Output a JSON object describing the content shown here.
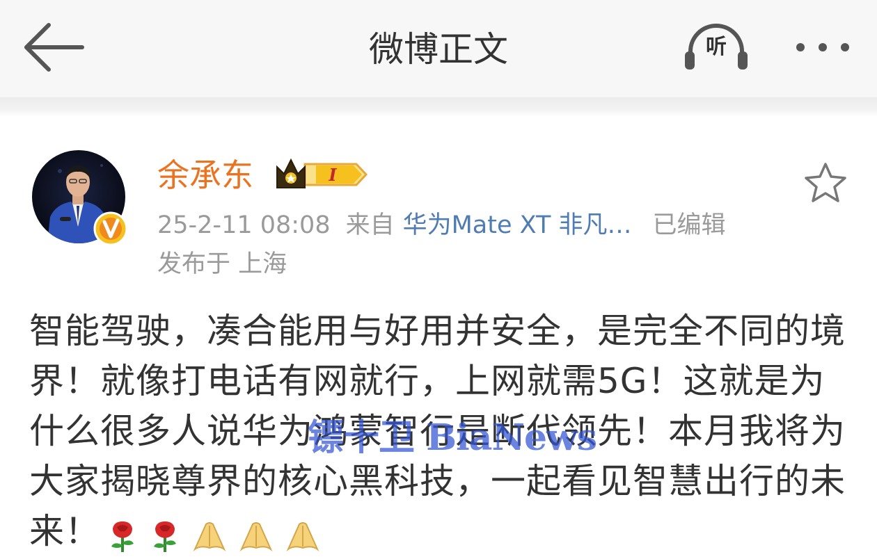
{
  "header": {
    "title": "微博正文",
    "listen_label": "听"
  },
  "post": {
    "author": "余承东",
    "timestamp": "25-2-11 08:08",
    "source_prefix": "来自",
    "source_device": "华为Mate XT 非凡…",
    "edited_label": "已编辑",
    "location": "发布于 上海",
    "content": "智能驾驶，凑合能用与好用并安全，是完全不同的境界！就像打电话有网就行，上网就需5G！这就是为什么很多人说华为鸿蒙智行是断代领先！本月我将为大家揭晓尊界的核心黑科技，一起看见智慧出行的未来！",
    "emojis": [
      "rose-icon",
      "rose-icon",
      "pray-icon",
      "pray-icon",
      "pray-icon"
    ]
  },
  "badges": {
    "vip_level": "I"
  },
  "watermark": "镖十卫 BiaNews",
  "colors": {
    "username": "#eb7320",
    "link": "#4f7cb3",
    "meta": "#9a9a9a",
    "badge_orange": "#f08a1c",
    "badge_gold": "#f6c11e"
  }
}
